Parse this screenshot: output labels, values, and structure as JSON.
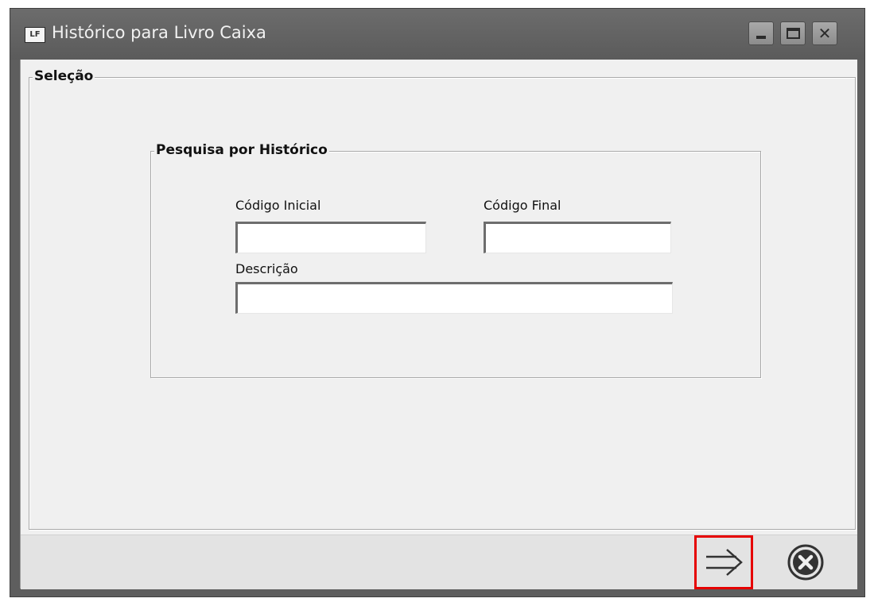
{
  "window": {
    "app_icon_text": "LF",
    "title": "Histórico para Livro Caixa",
    "controls": [
      "minimize-icon",
      "maximize-icon",
      "close-icon"
    ]
  },
  "selecao": {
    "title": "Seleção",
    "pesquisa": {
      "title": "Pesquisa por Histórico",
      "codigo_inicial": {
        "label": "Código Inicial",
        "value": ""
      },
      "codigo_final": {
        "label": "Código Final",
        "value": ""
      },
      "descricao": {
        "label": "Descrição",
        "value": ""
      }
    }
  },
  "actions": {
    "confirm_icon": "arrow-right-icon",
    "cancel_icon": "cancel-circle-icon",
    "highlight_color": "#e60000"
  }
}
